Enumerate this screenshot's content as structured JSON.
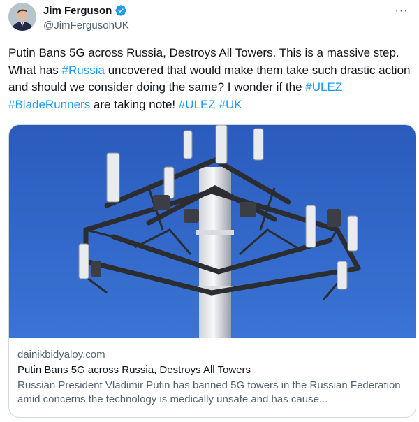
{
  "author": {
    "name": "Jim Ferguson",
    "handle": "@JimFergusonUK",
    "verified_badge_icon": "verified-badge-icon"
  },
  "menu": {
    "more_label": "···"
  },
  "tweet": {
    "segments": [
      {
        "text": "Putin Bans 5G across Russia, Destroys All Towers. This is a massive step. What has ",
        "hashtag": false
      },
      {
        "text": "#Russia",
        "hashtag": true
      },
      {
        "text": " uncovered that would make them take such drastic action and should we consider doing the same? I wonder if the ",
        "hashtag": false
      },
      {
        "text": "#ULEZ",
        "hashtag": true
      },
      {
        "text": " ",
        "hashtag": false
      },
      {
        "text": "#BladeRunners",
        "hashtag": true
      },
      {
        "text": " are taking note! ",
        "hashtag": false
      },
      {
        "text": "#ULEZ",
        "hashtag": true
      },
      {
        "text": " ",
        "hashtag": false
      },
      {
        "text": "#UK",
        "hashtag": true
      }
    ]
  },
  "link_card": {
    "domain": "dainikbidyaloy.com",
    "title": "Putin Bans 5G across Russia, Destroys All Towers",
    "description": "Russian President Vladimir Putin has banned 5G towers in the Russian Federation amid concerns the technology is medically unsafe and has cause..."
  },
  "colors": {
    "hashtag": "#1d9bf0",
    "verified": "#1d9bf0",
    "sky": "#2f64c6"
  }
}
